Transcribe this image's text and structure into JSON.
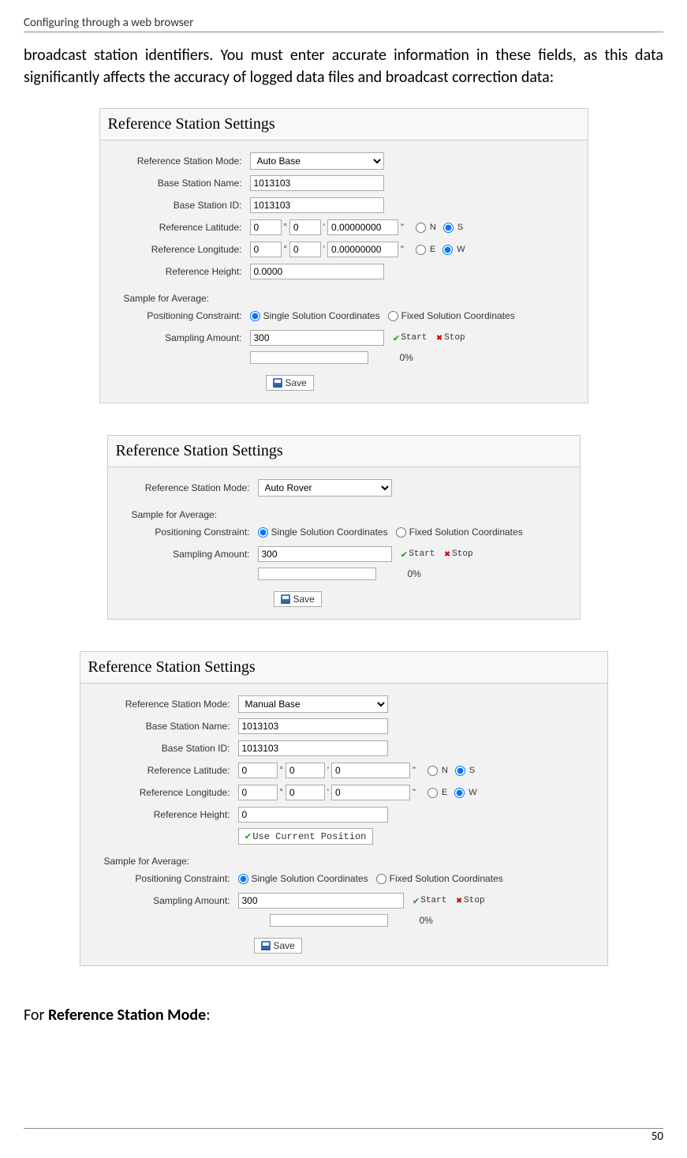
{
  "header": "Configuring through a web browser",
  "intro": "broadcast station identifiers. You must enter accurate information in these fields, as this data significantly affects the accuracy of logged data files and broadcast correction data:",
  "footer_prefix": "For ",
  "footer_bold": "Reference Station Mode",
  "footer_suffix": ":",
  "page_num": "50",
  "panels": {
    "p1": {
      "title": "Reference Station Settings",
      "labels": {
        "mode": "Reference Station Mode:",
        "name": "Base Station Name:",
        "id": "Base Station ID:",
        "lat": "Reference Latitude:",
        "lon": "Reference Longitude:",
        "height": "Reference Height:",
        "sample": "Sample for Average:",
        "pos": "Positioning Constraint:",
        "amt": "Sampling Amount:"
      },
      "values": {
        "mode": "Auto Base",
        "name": "1013103",
        "id": "1013103",
        "lat_d": "0",
        "lat_m": "0",
        "lat_s": "0.00000000",
        "lon_d": "0",
        "lon_m": "0",
        "lon_s": "0.00000000",
        "height": "0.0000",
        "amt": "300",
        "progress": "0%"
      },
      "radios": {
        "n": "N",
        "s": "S",
        "e": "E",
        "w": "W",
        "single": "Single Solution Coordinates",
        "fixed": "Fixed Solution Coordinates"
      },
      "buttons": {
        "start": "Start",
        "stop": "Stop",
        "save": "Save"
      }
    },
    "p2": {
      "title": "Reference Station Settings",
      "labels": {
        "mode": "Reference Station Mode:",
        "sample": "Sample for Average:",
        "pos": "Positioning Constraint:",
        "amt": "Sampling Amount:"
      },
      "values": {
        "mode": "Auto Rover",
        "amt": "300",
        "progress": "0%"
      },
      "radios": {
        "single": "Single Solution Coordinates",
        "fixed": "Fixed Solution Coordinates"
      },
      "buttons": {
        "start": "Start",
        "stop": "Stop",
        "save": "Save"
      }
    },
    "p3": {
      "title": "Reference Station Settings",
      "labels": {
        "mode": "Reference Station Mode:",
        "name": "Base Station Name:",
        "id": "Base Station ID:",
        "lat": "Reference Latitude:",
        "lon": "Reference Longitude:",
        "height": "Reference Height:",
        "sample": "Sample for Average:",
        "pos": "Positioning Constraint:",
        "amt": "Sampling Amount:"
      },
      "values": {
        "mode": "Manual Base",
        "name": "1013103",
        "id": "1013103",
        "lat_d": "0",
        "lat_m": "0",
        "lat_s": "0",
        "lon_d": "0",
        "lon_m": "0",
        "lon_s": "0",
        "height": "0",
        "amt": "300",
        "progress": "0%"
      },
      "radios": {
        "n": "N",
        "s": "S",
        "e": "E",
        "w": "W",
        "single": "Single Solution Coordinates",
        "fixed": "Fixed Solution Coordinates"
      },
      "buttons": {
        "usepos": "Use Current Position",
        "start": "Start",
        "stop": "Stop",
        "save": "Save"
      }
    }
  }
}
